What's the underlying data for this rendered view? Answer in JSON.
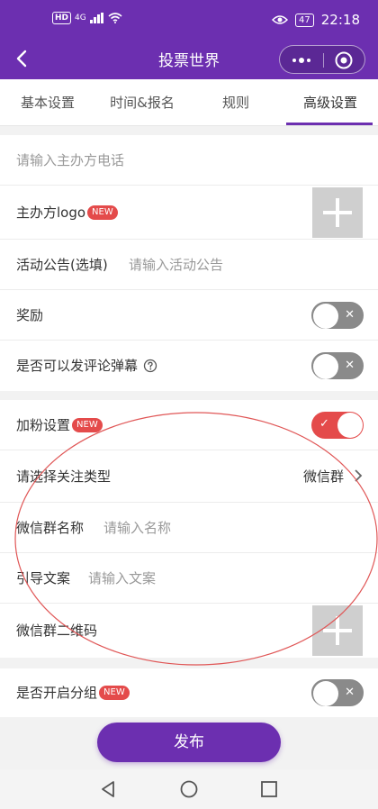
{
  "status_bar": {
    "hd": "HD",
    "network": "4G",
    "battery": "47",
    "time": "22:18"
  },
  "nav": {
    "title": "投票世界"
  },
  "tabs": [
    {
      "label": "基本设置"
    },
    {
      "label": "时间&报名"
    },
    {
      "label": "规则"
    },
    {
      "label": "高级设置",
      "active": true
    }
  ],
  "section1": {
    "phone_placeholder": "请输入主办方电话",
    "logo_label": "主办方logo",
    "new_badge": "NEW",
    "notice_label": "活动公告(选填)",
    "notice_placeholder": "请输入活动公告",
    "reward_label": "奖励",
    "reward_on": false,
    "comment_label": "是否可以发评论弹幕",
    "comment_on": false
  },
  "section2": {
    "fans_label": "加粉设置",
    "fans_on": true,
    "follow_type_label": "请选择关注类型",
    "follow_type_value": "微信群",
    "group_name_label": "微信群名称",
    "group_name_placeholder": "请输入名称",
    "guide_label": "引导文案",
    "guide_placeholder": "请输入文案",
    "qrcode_label": "微信群二维码"
  },
  "section3": {
    "grouping_label": "是否开启分组",
    "grouping_on": false
  },
  "publish_label": "发布",
  "colors": {
    "primary": "#6c2fb0",
    "badge": "#e44b4b",
    "annotation": "#e05656"
  }
}
